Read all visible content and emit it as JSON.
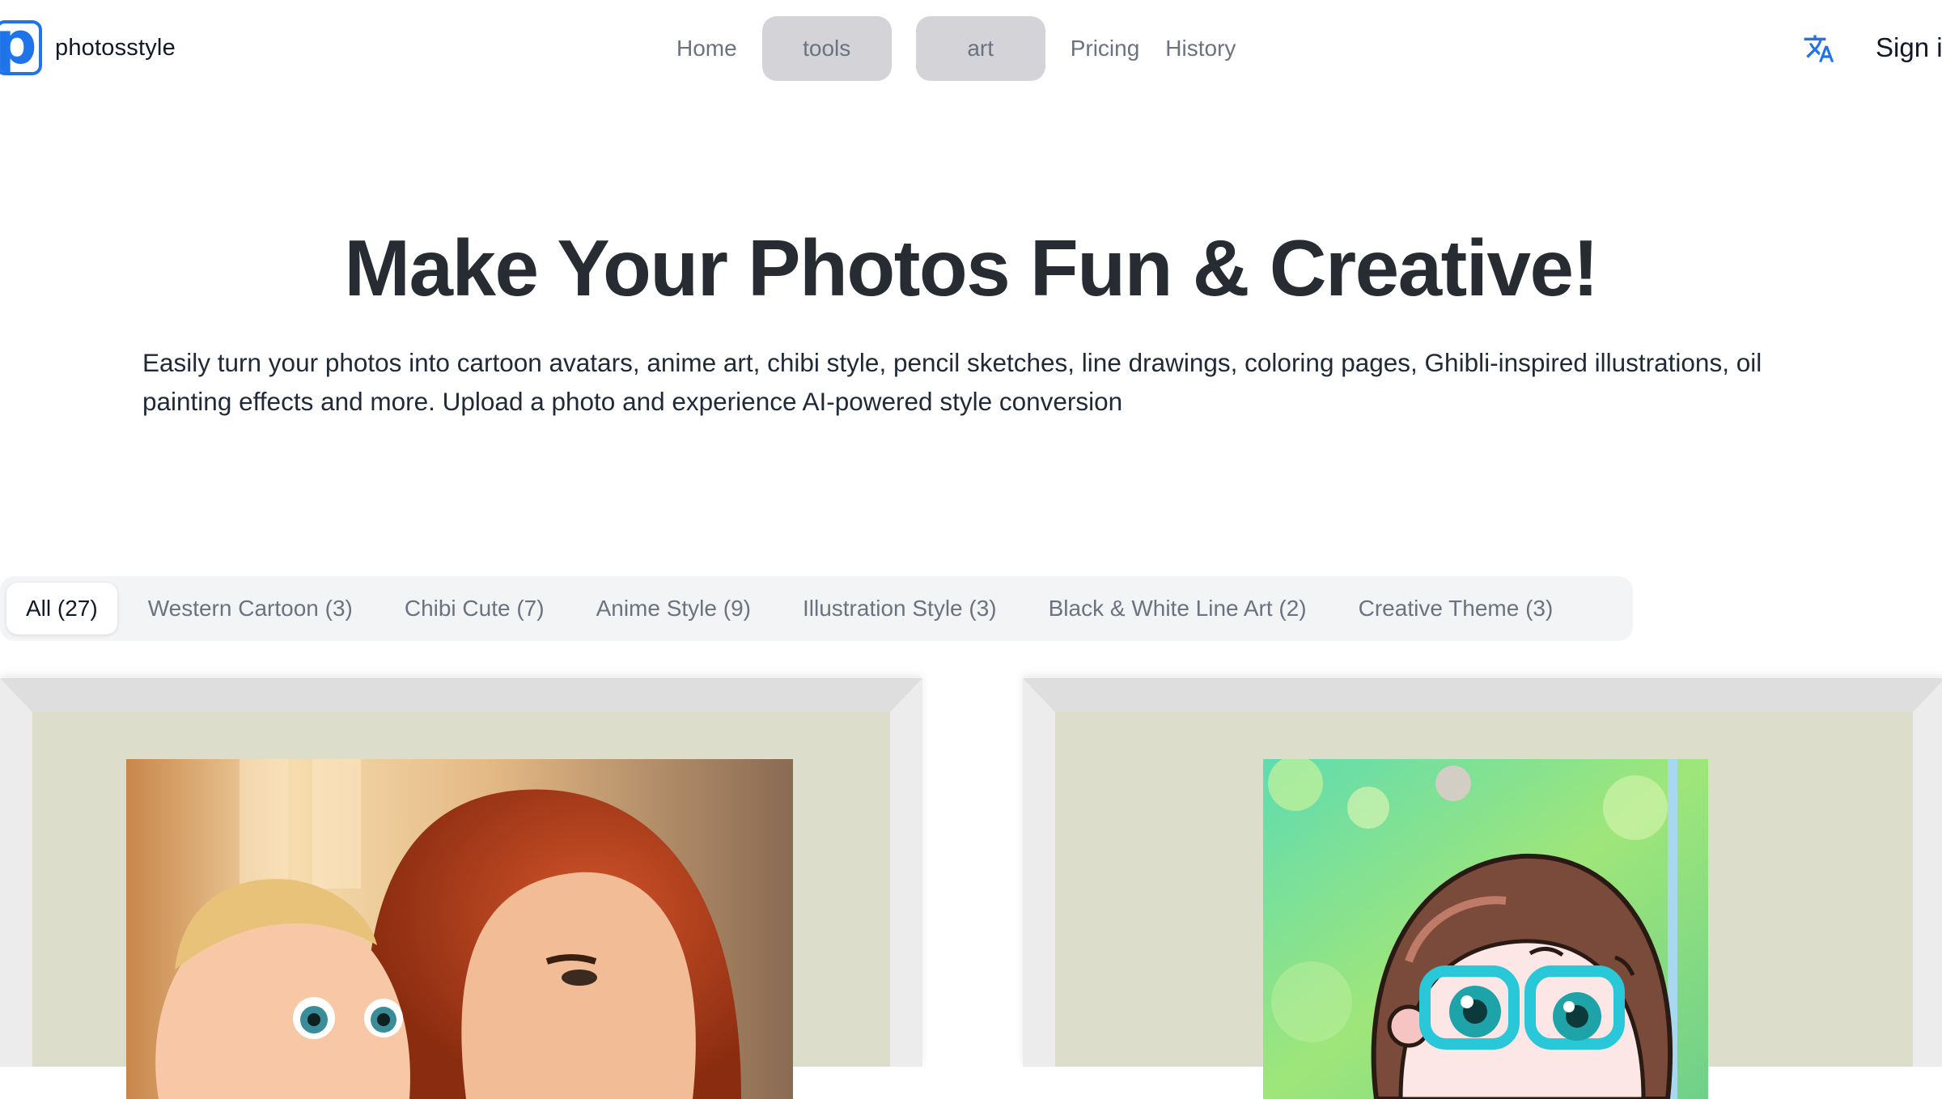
{
  "brand": {
    "logo_letter": "p",
    "name": "photosstyle"
  },
  "nav": {
    "home": "Home",
    "tools": "tools",
    "art": "art",
    "pricing": "Pricing",
    "history": "History"
  },
  "header": {
    "signin": "Sign i"
  },
  "hero": {
    "title": "Make Your Photos Fun & Creative!",
    "description": "Easily turn your photos into cartoon avatars, anime art, chibi style, pencil sketches, line drawings, coloring pages, Ghibli-inspired illustrations, oil painting effects and more. Upload a photo and experience AI-powered style conversion"
  },
  "filters": [
    {
      "label": "All (27)",
      "active": true
    },
    {
      "label": "Western Cartoon (3)",
      "active": false
    },
    {
      "label": "Chibi Cute (7)",
      "active": false
    },
    {
      "label": "Anime Style (9)",
      "active": false
    },
    {
      "label": "Illustration Style (3)",
      "active": false
    },
    {
      "label": "Black & White Line Art (2)",
      "active": false
    },
    {
      "label": "Creative Theme (3)",
      "active": false
    }
  ],
  "colors": {
    "brand_blue": "#1f74ea",
    "pill_bg": "#d4d4d8",
    "title_text": "#272c33",
    "frame_mat": "#dcddcb"
  },
  "icons": {
    "translate": "translate-icon"
  }
}
